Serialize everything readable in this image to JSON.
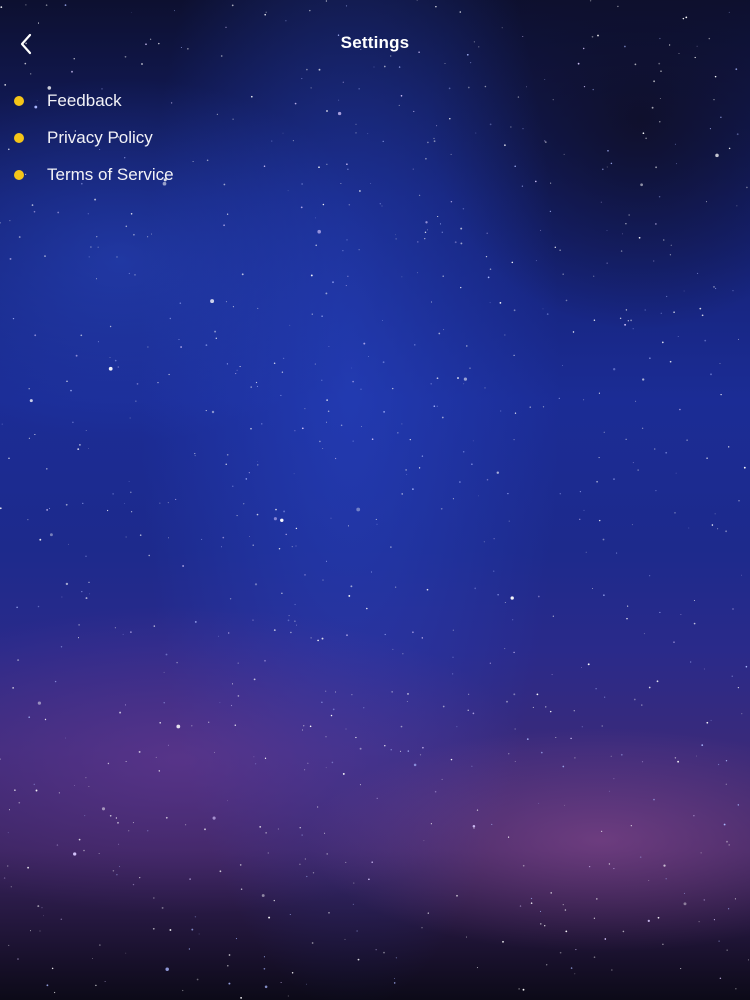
{
  "theme": {
    "accent_color": "#F5C518",
    "text_color": "#FFFFFF"
  },
  "background": {
    "description_icon": "starry-sky-background"
  },
  "header": {
    "title": "Settings",
    "back_icon": "chevron-left-icon"
  },
  "menu": {
    "items": [
      {
        "label": "Feedback",
        "bullet_icon": "dot-icon"
      },
      {
        "label": "Privacy Policy",
        "bullet_icon": "dot-icon"
      },
      {
        "label": "Terms of Service",
        "bullet_icon": "dot-icon"
      }
    ]
  }
}
